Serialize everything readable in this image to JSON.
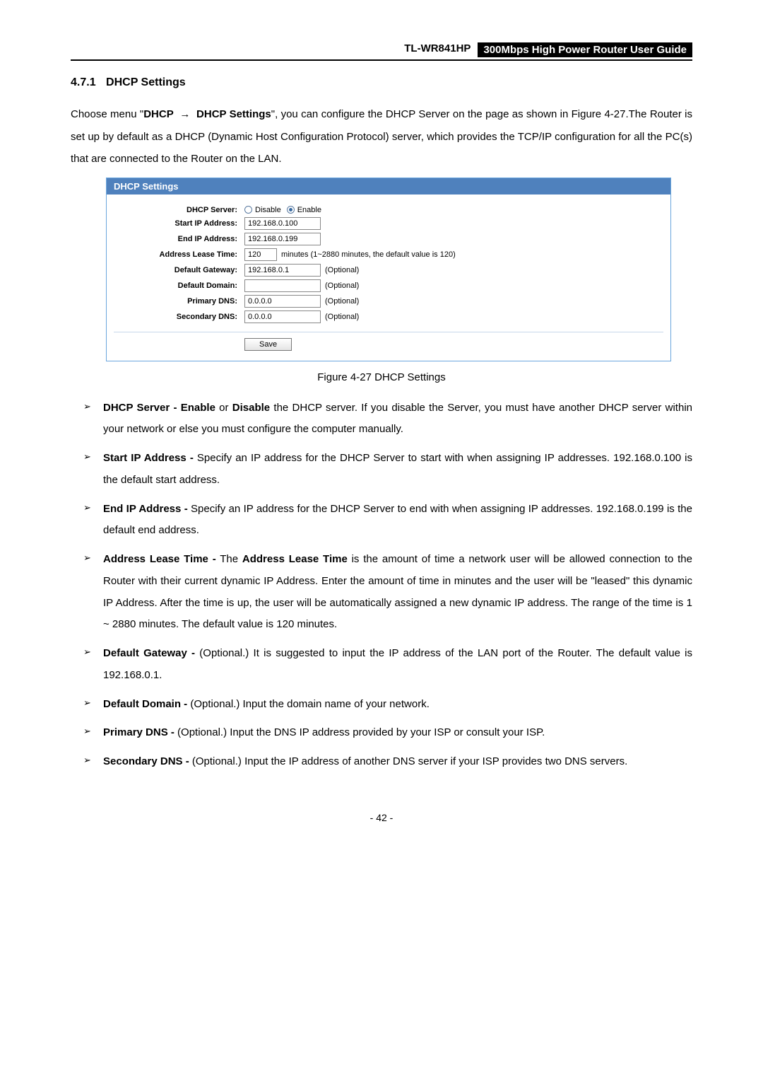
{
  "header": {
    "model": "TL-WR841HP",
    "title": "300Mbps High Power Router User Guide"
  },
  "section": {
    "number": "4.7.1",
    "title": "DHCP Settings"
  },
  "intro": {
    "p1a": "Choose menu \"",
    "p1b": "DHCP",
    "p1c": "DHCP Settings",
    "p1d": "\", you can configure the DHCP Server on the page as shown in Figure 4-27.The Router is set up by default as a DHCP (Dynamic Host Configuration Protocol) server, which provides the TCP/IP configuration for all the PC(s) that are connected to the Router on the LAN."
  },
  "fig": {
    "panel_title": "DHCP Settings",
    "rows": {
      "dhcp_server": {
        "label": "DHCP Server:",
        "opt_disable": "Disable",
        "opt_enable": "Enable"
      },
      "start_ip": {
        "label": "Start IP Address:",
        "value": "192.168.0.100"
      },
      "end_ip": {
        "label": "End IP Address:",
        "value": "192.168.0.199"
      },
      "lease": {
        "label": "Address Lease Time:",
        "value": "120",
        "note": "minutes (1~2880 minutes, the default value is 120)"
      },
      "gateway": {
        "label": "Default Gateway:",
        "value": "192.168.0.1",
        "note": "(Optional)"
      },
      "domain": {
        "label": "Default Domain:",
        "value": "",
        "note": "(Optional)"
      },
      "pdns": {
        "label": "Primary DNS:",
        "value": "0.0.0.0",
        "note": "(Optional)"
      },
      "sdns": {
        "label": "Secondary DNS:",
        "value": "0.0.0.0",
        "note": "(Optional)"
      }
    },
    "save": "Save",
    "caption": "Figure 4-27 DHCP Settings"
  },
  "items": {
    "i1_strong": "DHCP Server - Enable",
    "i1_mid": " or ",
    "i1_strong2": "Disable",
    "i1_rest": " the DHCP server. If you disable the Server, you must have another DHCP server within your network or else you must configure the computer manually.",
    "i2_strong": "Start IP Address -",
    "i2_rest": " Specify an IP address for the DHCP Server to start with when assigning IP addresses. 192.168.0.100 is the default start address.",
    "i3_strong": "End IP Address -",
    "i3_rest": " Specify an IP address for the DHCP Server to end with when assigning IP addresses. 192.168.0.199 is the default end address.",
    "i4_strong": "Address Lease Time -",
    "i4_mid": " The ",
    "i4_strong2": "Address Lease Time",
    "i4_rest": " is the amount of time a network user will be allowed connection to the Router with their current dynamic IP Address. Enter the amount of time in minutes and the user will be \"leased\" this dynamic IP Address. After the time is up, the user will be automatically assigned a new dynamic IP address. The range of the time is 1 ~ 2880 minutes. The default value is 120 minutes.",
    "i5_strong": "Default Gateway -",
    "i5_rest": " (Optional.) It is suggested to input the IP address of the LAN port of the Router. The default value is 192.168.0.1.",
    "i6_strong": "Default Domain -",
    "i6_rest": " (Optional.) Input the domain name of your network.",
    "i7_strong": "Primary DNS -",
    "i7_rest": " (Optional.) Input the DNS IP address provided by your ISP or consult your ISP.",
    "i8_strong": "Secondary DNS -",
    "i8_rest": " (Optional.) Input the IP address of another DNS server if your ISP provides two DNS servers."
  },
  "page_number": "- 42 -"
}
